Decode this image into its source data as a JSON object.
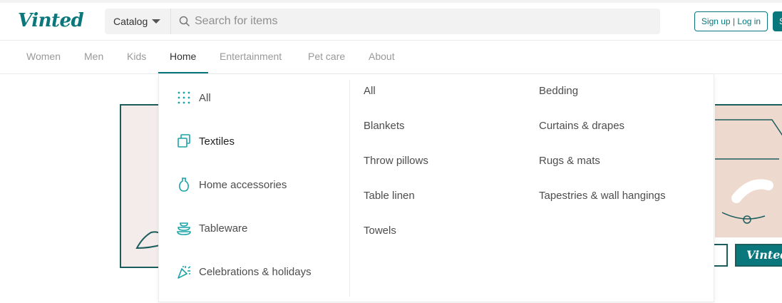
{
  "brand": {
    "logo_text": "Vinted",
    "accent": "#09777c"
  },
  "search": {
    "catalog_label": "Catalog",
    "placeholder": "Search for items"
  },
  "header": {
    "signup_login_label": "Sign up | Log in",
    "sell_label": "S"
  },
  "nav": {
    "items": [
      "Women",
      "Men",
      "Kids",
      "Home",
      "Entertainment",
      "Pet care",
      "About"
    ],
    "active": "Home"
  },
  "dropdown": {
    "categories": [
      {
        "label": "All",
        "icon": "grid-icon"
      },
      {
        "label": "Textiles",
        "icon": "textiles-icon"
      },
      {
        "label": "Home accessories",
        "icon": "vase-icon"
      },
      {
        "label": "Tableware",
        "icon": "tableware-icon"
      },
      {
        "label": "Celebrations & holidays",
        "icon": "party-popper-icon"
      }
    ],
    "selected_category": "Textiles",
    "subcategories": {
      "col1": [
        "All",
        "Blankets",
        "Throw pillows",
        "Table linen",
        "Towels"
      ],
      "col2": [
        "Bedding",
        "Curtains & drapes",
        "Rugs & mats",
        "Tapestries & wall hangings"
      ]
    }
  },
  "banner": {
    "logo_text": "Vinted"
  }
}
